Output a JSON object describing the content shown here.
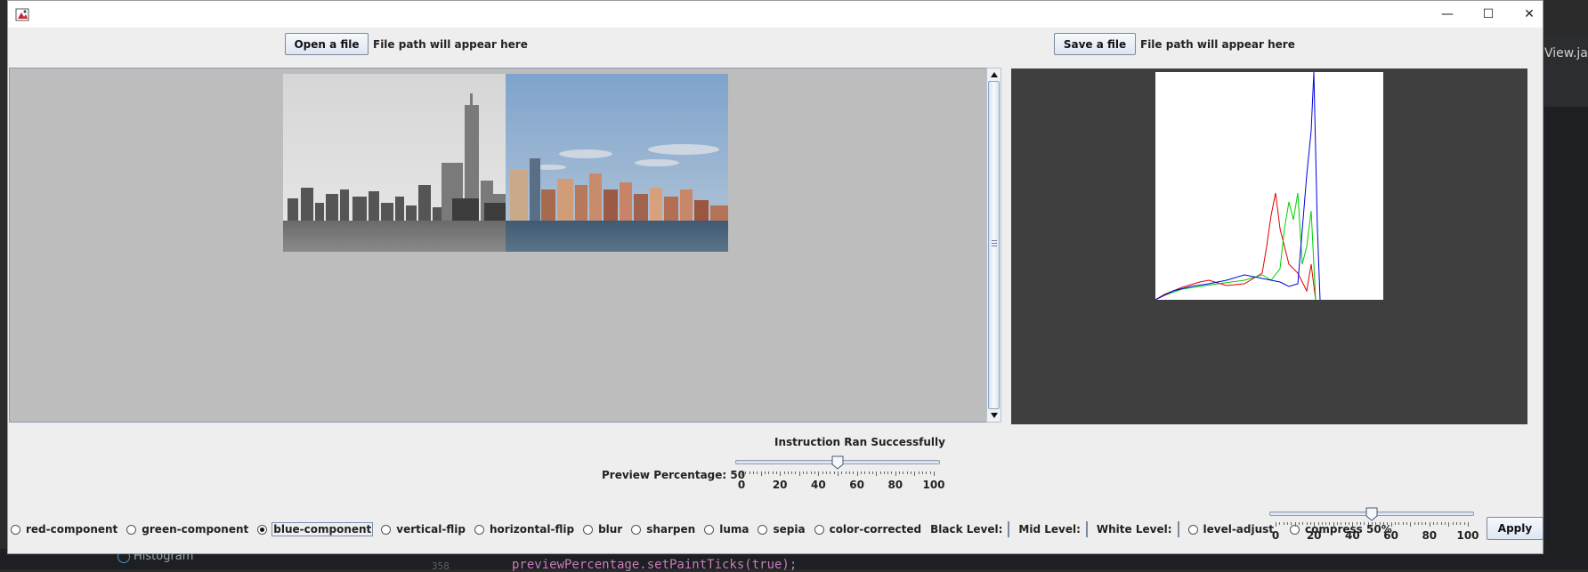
{
  "ide": {
    "right_tab": "View.jav",
    "histogram_item": "Histogram",
    "line_number": "358",
    "code_line": "previewPercentage.setPaintTicks(true);"
  },
  "window": {
    "minimize": "—",
    "maximize": "☐",
    "close": "✕"
  },
  "open": {
    "button": "Open a file",
    "path": "File path will appear here"
  },
  "save": {
    "button": "Save a file",
    "path": "File path will appear here"
  },
  "status": "Instruction Ran Successfully",
  "preview_slider": {
    "label": "Preview Percentage: 50",
    "value": 50,
    "ticks": [
      "0",
      "20",
      "40",
      "60",
      "80",
      "100"
    ]
  },
  "operations": [
    {
      "label": "red-component",
      "selected": false
    },
    {
      "label": "green-component",
      "selected": false
    },
    {
      "label": "blue-component",
      "selected": true
    },
    {
      "label": "vertical-flip",
      "selected": false
    },
    {
      "label": "horizontal-flip",
      "selected": false
    },
    {
      "label": "blur",
      "selected": false
    },
    {
      "label": "sharpen",
      "selected": false
    },
    {
      "label": "luma",
      "selected": false
    },
    {
      "label": "sepia",
      "selected": false
    },
    {
      "label": "color-corrected",
      "selected": false
    }
  ],
  "levels": {
    "black_label": "Black Level:",
    "mid_label": "Mid Level:",
    "white_label": "White Level:",
    "black_value": "",
    "mid_value": "",
    "white_value": ""
  },
  "level_adjust": {
    "label": "level-adjust",
    "selected": false
  },
  "compress": {
    "label": "compress 50%",
    "selected": false
  },
  "compress_slider": {
    "value": 50,
    "ticks": [
      "0",
      "20",
      "40",
      "60",
      "80",
      "100"
    ]
  },
  "apply_button": "Apply",
  "colors": {
    "red": "#e00000",
    "green": "#00d000",
    "blue": "#0000e0",
    "panel_bg": "#bdbdbd",
    "histogram_bg": "#3f3f3f"
  },
  "histogram_data": {
    "red": [
      [
        0,
        0
      ],
      [
        10,
        6
      ],
      [
        30,
        14
      ],
      [
        50,
        20
      ],
      [
        60,
        22
      ],
      [
        80,
        16
      ],
      [
        100,
        18
      ],
      [
        120,
        30
      ],
      [
        125,
        60
      ],
      [
        130,
        95
      ],
      [
        135,
        120
      ],
      [
        140,
        80
      ],
      [
        145,
        60
      ],
      [
        150,
        40
      ],
      [
        160,
        30
      ],
      [
        170,
        10
      ],
      [
        175,
        40
      ],
      [
        180,
        0
      ]
    ],
    "green": [
      [
        0,
        0
      ],
      [
        10,
        5
      ],
      [
        30,
        12
      ],
      [
        50,
        15
      ],
      [
        70,
        18
      ],
      [
        100,
        22
      ],
      [
        120,
        28
      ],
      [
        130,
        22
      ],
      [
        140,
        35
      ],
      [
        145,
        80
      ],
      [
        150,
        110
      ],
      [
        155,
        90
      ],
      [
        160,
        120
      ],
      [
        165,
        40
      ],
      [
        170,
        60
      ],
      [
        175,
        100
      ],
      [
        180,
        0
      ]
    ],
    "blue": [
      [
        0,
        0
      ],
      [
        20,
        10
      ],
      [
        40,
        15
      ],
      [
        60,
        18
      ],
      [
        80,
        22
      ],
      [
        100,
        28
      ],
      [
        120,
        24
      ],
      [
        140,
        20
      ],
      [
        150,
        15
      ],
      [
        160,
        18
      ],
      [
        170,
        140
      ],
      [
        175,
        190
      ],
      [
        178,
        256
      ],
      [
        182,
        80
      ],
      [
        185,
        0
      ]
    ]
  }
}
